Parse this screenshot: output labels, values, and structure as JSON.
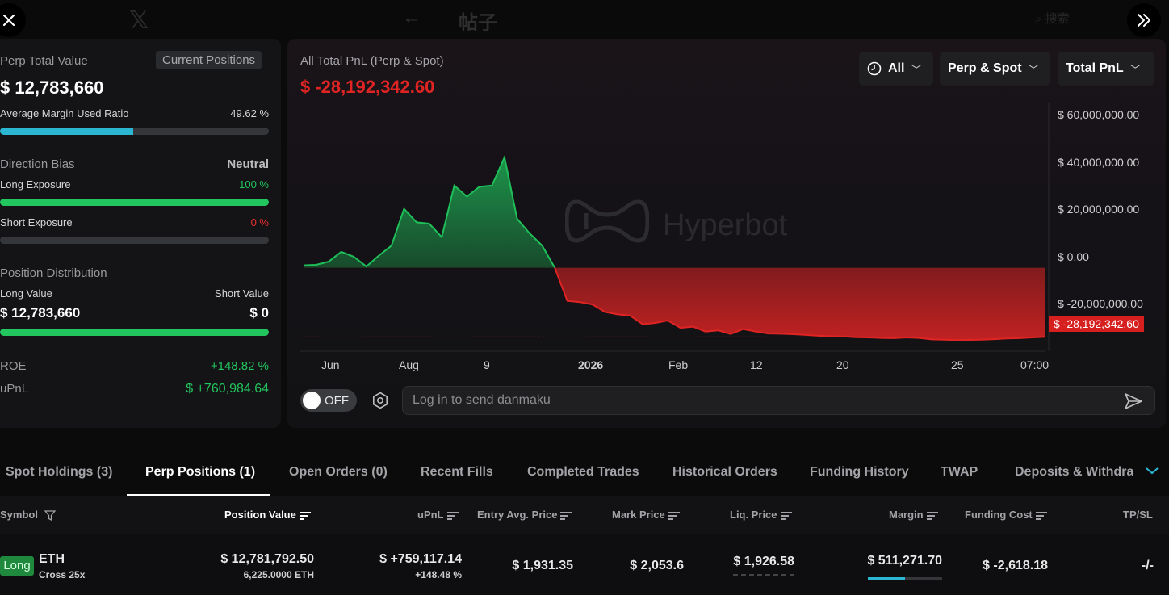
{
  "top": {
    "title": "帖子",
    "search": "搜索"
  },
  "left": {
    "perp_total_label": "Perp Total Value",
    "current_positions": "Current Positions",
    "perp_total_value": "$ 12,783,660",
    "margin_ratio_label": "Average Margin Used Ratio",
    "margin_ratio_value": "49.62 %",
    "margin_ratio_fraction": 0.4962,
    "direction_bias_label": "Direction Bias",
    "direction_bias_value": "Neutral",
    "long_exposure_label": "Long Exposure",
    "long_exposure_value": "100 %",
    "short_exposure_label": "Short Exposure",
    "short_exposure_value": "0 %",
    "position_distribution_label": "Position Distribution",
    "long_value_label": "Long Value",
    "short_value_label": "Short Value",
    "long_value": "$ 12,783,660",
    "short_value": "$ 0",
    "roe_label": "ROE",
    "roe_value": "+148.82 %",
    "upnl_label": "uPnL",
    "upnl_value": "$ +760,984.64",
    "colors": {
      "margin": "#2bb7d1",
      "long": "#22c55e",
      "short_track": "#34363a"
    }
  },
  "chart_panel": {
    "title": "All Total PnL (Perp & Spot)",
    "value": "$ -28,192,342.60",
    "dropdowns": [
      "All",
      "Perp & Spot",
      "Total PnL"
    ],
    "y_ticks": [
      "$ 60,000,000.00",
      "$ 40,000,000.00",
      "$ 20,000,000.00",
      "$ 0.00",
      "$ -20,000,000.00"
    ],
    "current_label": "$ -28,192,342.60",
    "x_ticks": [
      "Jun",
      "Aug",
      "9",
      "2026",
      "Feb",
      "12",
      "20",
      "25",
      "07:00"
    ],
    "watermark": "Hyperbot",
    "toggle_label": "OFF",
    "danmaku_placeholder": "Log in to send danmaku"
  },
  "chart_data": {
    "type": "area",
    "ylim": [
      -34000000,
      67000000
    ],
    "grid": false,
    "values": [
      1000000,
      1200000,
      2500000,
      6500000,
      4500000,
      500000,
      5000000,
      9000000,
      24000000,
      18500000,
      18000000,
      12500000,
      33500000,
      29000000,
      33000000,
      33500000,
      45000000,
      20000000,
      14000000,
      9000000,
      0,
      -13500000,
      -14000000,
      -15000000,
      -18000000,
      -19000000,
      -19500000,
      -23000000,
      -22500000,
      -21500000,
      -24500000,
      -24000000,
      -26000000,
      -25500000,
      -27000000,
      -25000000,
      -26000000,
      -26800000,
      -26900000,
      -27100000,
      -27400000,
      -27700000,
      -27900000,
      -28000000,
      -28300000,
      -28400000,
      -28600000,
      -28700000,
      -28400000,
      -28600000,
      -29200000,
      -29300000,
      -29500000,
      -29400000,
      -29300000,
      -29100000,
      -28800000,
      -28700000,
      -28400000,
      -28192342.6
    ],
    "colors": {
      "positive": "#1fbf5a",
      "negative": "#e02424"
    }
  },
  "tabs": [
    "Spot Holdings (3)",
    "Perp Positions (1)",
    "Open Orders (0)",
    "Recent Fills",
    "Completed Trades",
    "Historical Orders",
    "Funding History",
    "TWAP",
    "Deposits & Withdraw"
  ],
  "table": {
    "headers": [
      "Symbol",
      "Position Value",
      "uPnL",
      "Entry Avg. Price",
      "Mark Price",
      "Liq. Price",
      "Margin",
      "Funding Cost",
      "TP/SL"
    ],
    "row": {
      "side": "Long",
      "symbol": "ETH",
      "leverage": "Cross 25x",
      "position_value": "$ 12,781,792.50",
      "position_size": "6,225.0000 ETH",
      "upnl": "$ +759,117.14",
      "upnl_pct": "+148.48 %",
      "entry_price": "$ 1,931.35",
      "mark_price": "$ 2,053.6",
      "liq_price": "$ 1,926.58",
      "margin": "$ 511,271.70",
      "margin_fraction": 0.4962,
      "funding_cost": "$ -2,618.18",
      "tpsl": "-/-"
    }
  }
}
